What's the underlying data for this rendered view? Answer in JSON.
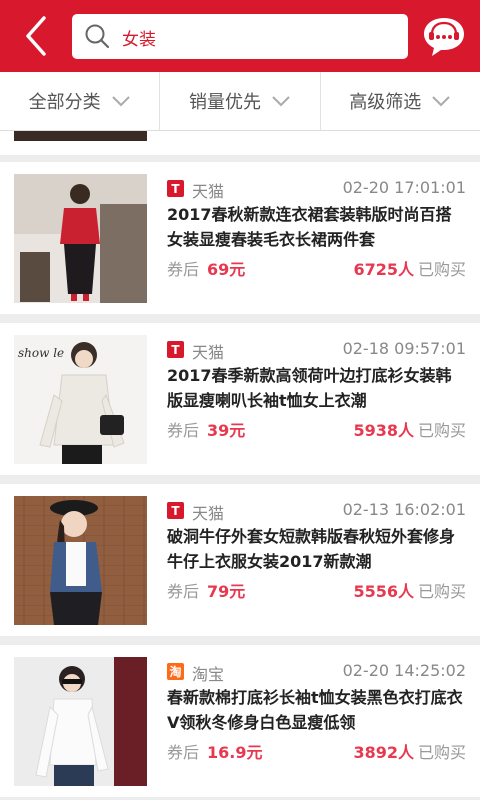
{
  "header": {
    "search_value": "女装",
    "icons": {
      "back": "chevron-left-icon",
      "search": "search-icon",
      "service": "customer-service-chat-icon"
    }
  },
  "filters": [
    {
      "label": "全部分类",
      "icon": "chevron-down-icon"
    },
    {
      "label": "销量优先",
      "icon": "chevron-down-icon"
    },
    {
      "label": "高级筛选",
      "icon": "chevron-down-icon"
    }
  ],
  "colors": {
    "brand": "#d8182d",
    "price": "#e8384f",
    "tmall": "#d8182d",
    "taobao": "#ff6a1a"
  },
  "products": [
    {
      "shop_icon_text": "T",
      "shop_name": "天猫",
      "time": "02-20 17:01:01",
      "title": "2017春秋新款连衣裙套装韩版时尚百搭女装显瘦春装毛衣长裙两件套",
      "price_label": "券后",
      "price": "69元",
      "buyers": "6725人",
      "buyers_suffix": "已购买"
    },
    {
      "shop_icon_text": "T",
      "shop_name": "天猫",
      "time": "02-18 09:57:01",
      "title": "2017春季新款高领荷叶边打底衫女装韩版显瘦喇叭长袖t恤女上衣潮",
      "price_label": "券后",
      "price": "39元",
      "buyers": "5938人",
      "buyers_suffix": "已购买",
      "image_text": "show le"
    },
    {
      "shop_icon_text": "T",
      "shop_name": "天猫",
      "time": "02-13 16:02:01",
      "title": "破洞牛仔外套女短款韩版春秋短外套修身牛仔上衣服女装2017新款潮",
      "price_label": "券后",
      "price": "79元",
      "buyers": "5556人",
      "buyers_suffix": "已购买"
    },
    {
      "shop_icon_text": "淘",
      "shop_name": "淘宝",
      "time": "02-20 14:25:02",
      "title": "春新款棉打底衫长袖t恤女装黑色衣打底衣V领秋冬修身白色显瘦低领",
      "price_label": "券后",
      "price": "16.9元",
      "buyers": "3892人",
      "buyers_suffix": "已购买"
    }
  ]
}
